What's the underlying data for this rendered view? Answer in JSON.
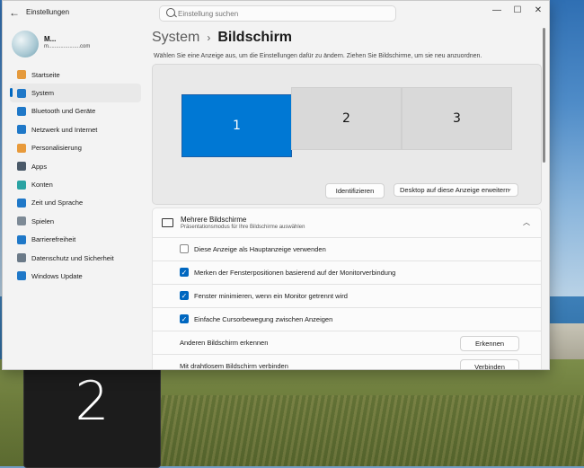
{
  "window": {
    "app_title": "Einstellungen",
    "search_placeholder": "Einstellung suchen",
    "controls": {
      "minimize": "—",
      "maximize": "☐",
      "close": "✕"
    }
  },
  "profile": {
    "name": "M...",
    "email": "m.....................com"
  },
  "sidebar": {
    "items": [
      {
        "label": "Startseite",
        "icon": "home-icon",
        "color": "#e59a3c"
      },
      {
        "label": "System",
        "icon": "system-icon",
        "color": "#1f78c8",
        "active": true
      },
      {
        "label": "Bluetooth und Geräte",
        "icon": "bluetooth-icon",
        "color": "#1f78c8"
      },
      {
        "label": "Netzwerk und Internet",
        "icon": "network-icon",
        "color": "#1f78c8"
      },
      {
        "label": "Personalisierung",
        "icon": "brush-icon",
        "color": "#e89a3a"
      },
      {
        "label": "Apps",
        "icon": "apps-icon",
        "color": "#4a5968"
      },
      {
        "label": "Konten",
        "icon": "account-icon",
        "color": "#2aa3a3"
      },
      {
        "label": "Zeit und Sprache",
        "icon": "globe-clock-icon",
        "color": "#1f78c8"
      },
      {
        "label": "Spielen",
        "icon": "gamepad-icon",
        "color": "#7d8a96"
      },
      {
        "label": "Barrierefreiheit",
        "icon": "accessibility-icon",
        "color": "#1f78c8"
      },
      {
        "label": "Datenschutz und Sicherheit",
        "icon": "shield-icon",
        "color": "#6b7a88"
      },
      {
        "label": "Windows Update",
        "icon": "update-icon",
        "color": "#1f78c8"
      }
    ]
  },
  "main": {
    "breadcrumb_parent": "System",
    "breadcrumb_separator": "›",
    "breadcrumb_current": "Bildschirm",
    "hint": "Wählen Sie eine Anzeige aus, um die Einstellungen dafür zu ändern. Ziehen Sie Bildschirme, um sie neu anzuordnen.",
    "monitors": [
      "1",
      "2",
      "3"
    ],
    "identify_button": "Identifizieren",
    "extend_select": "Desktop auf diese Anzeige erweitern",
    "multi": {
      "title": "Mehrere Bildschirme",
      "subtitle": "Präsentationsmodus für Ihre Bildschirme auswählen"
    },
    "options": [
      {
        "label": "Diese Anzeige als Hauptanzeige verwenden",
        "checked": false
      },
      {
        "label": "Merken der Fensterpositionen basierend auf der Monitorverbindung",
        "checked": true
      },
      {
        "label": "Fenster minimieren, wenn ein Monitor getrennt wird",
        "checked": true
      },
      {
        "label": "Einfache Cursorbewegung zwischen Anzeigen",
        "checked": true
      }
    ],
    "detect": {
      "label": "Anderen Bildschirm erkennen",
      "button": "Erkennen"
    },
    "wireless": {
      "label": "Mit drahtlosem Bildschirm verbinden",
      "button": "Verbinden"
    }
  },
  "identify_overlay": {
    "number": "2"
  },
  "colors": {
    "accent": "#0067c0",
    "monitor_selected": "#0078d4"
  }
}
